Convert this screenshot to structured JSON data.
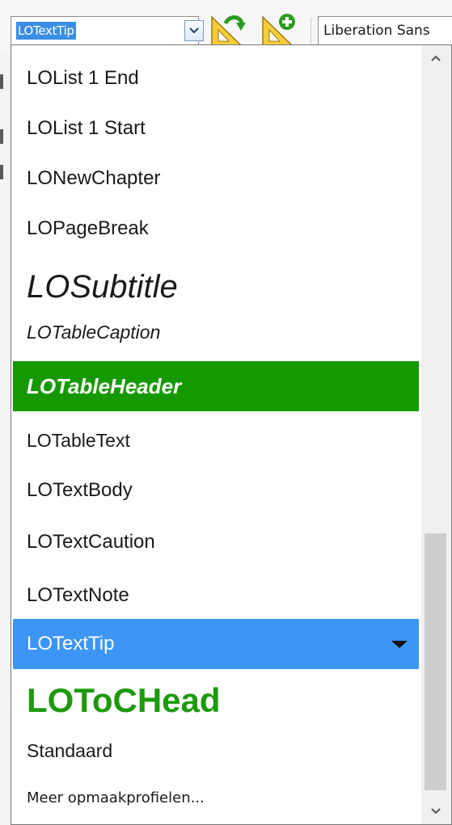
{
  "toolbar": {
    "style_value": "LOTextTip",
    "font_value": "Liberation Sans",
    "icons": [
      "update-style-icon",
      "new-style-icon"
    ]
  },
  "dropdown": {
    "items": [
      {
        "label": "LOList 1 End"
      },
      {
        "label": "LOList 1 Start"
      },
      {
        "label": "LONewChapter"
      },
      {
        "label": "LOPageBreak"
      },
      {
        "label": "LOSubtitle"
      },
      {
        "label": "LOTableCaption"
      },
      {
        "label": "LOTableHeader"
      },
      {
        "label": "LOTableText"
      },
      {
        "label": "LOTextBody"
      },
      {
        "label": "LOTextCaution"
      },
      {
        "label": "LOTextNote"
      },
      {
        "label": "LOTextTip"
      },
      {
        "label": "LOToCHead"
      },
      {
        "label": "Standaard"
      },
      {
        "label": "Meer opmaakprofielen..."
      }
    ],
    "selected": "LOTextTip",
    "scroll_position": 0.68
  },
  "colors": {
    "selection_blue": "#3d95f5",
    "header_green": "#169900",
    "toc_green": "#1c9a0c"
  }
}
